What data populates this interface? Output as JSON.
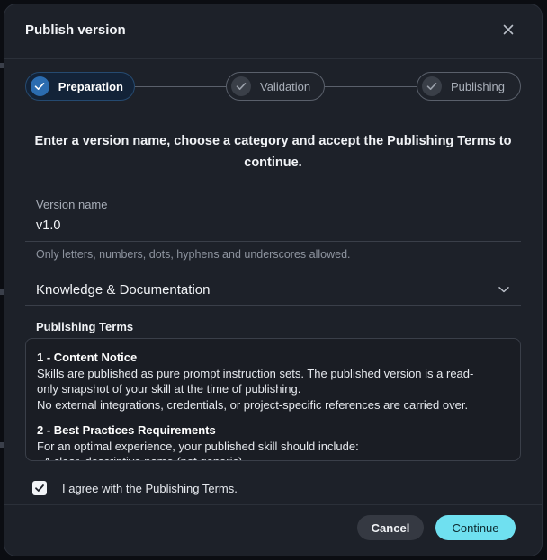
{
  "dialog": {
    "title": "Publish version",
    "stepper": {
      "steps": [
        {
          "label": "Preparation",
          "state": "active"
        },
        {
          "label": "Validation",
          "state": "pending"
        },
        {
          "label": "Publishing",
          "state": "pending"
        }
      ]
    },
    "instruction": "Enter a version name, choose a category and accept the Publishing Terms to continue.",
    "version_field": {
      "label": "Version name",
      "value": "v1.0",
      "hint": "Only letters, numbers, dots, hyphens and underscores allowed."
    },
    "category_select": {
      "value": "Knowledge & Documentation",
      "icon": "chevron-down-icon"
    },
    "terms": {
      "title": "Publishing Terms",
      "sections": [
        {
          "heading": "1 - Content Notice",
          "paragraphs": [
            "Skills are published as pure prompt instruction sets. The published version is a read-only snapshot of your skill at the time of publishing.",
            "No external integrations, credentials, or project-specific references are carried over."
          ]
        },
        {
          "heading": "2 - Best Practices Requirements",
          "paragraphs": [
            "For an optimal experience, your published skill should include:",
            "- A clear, descriptive name (not generic)"
          ]
        }
      ]
    },
    "agree": {
      "label": "I agree with the Publishing Terms.",
      "checked": true
    },
    "footer": {
      "cancel_label": "Cancel",
      "continue_label": "Continue"
    }
  },
  "colors": {
    "dialog_bg": "#1d2129",
    "active_step": "#2b6cb0",
    "primary_button": "#6fe0f0",
    "secondary_button": "#353942"
  }
}
